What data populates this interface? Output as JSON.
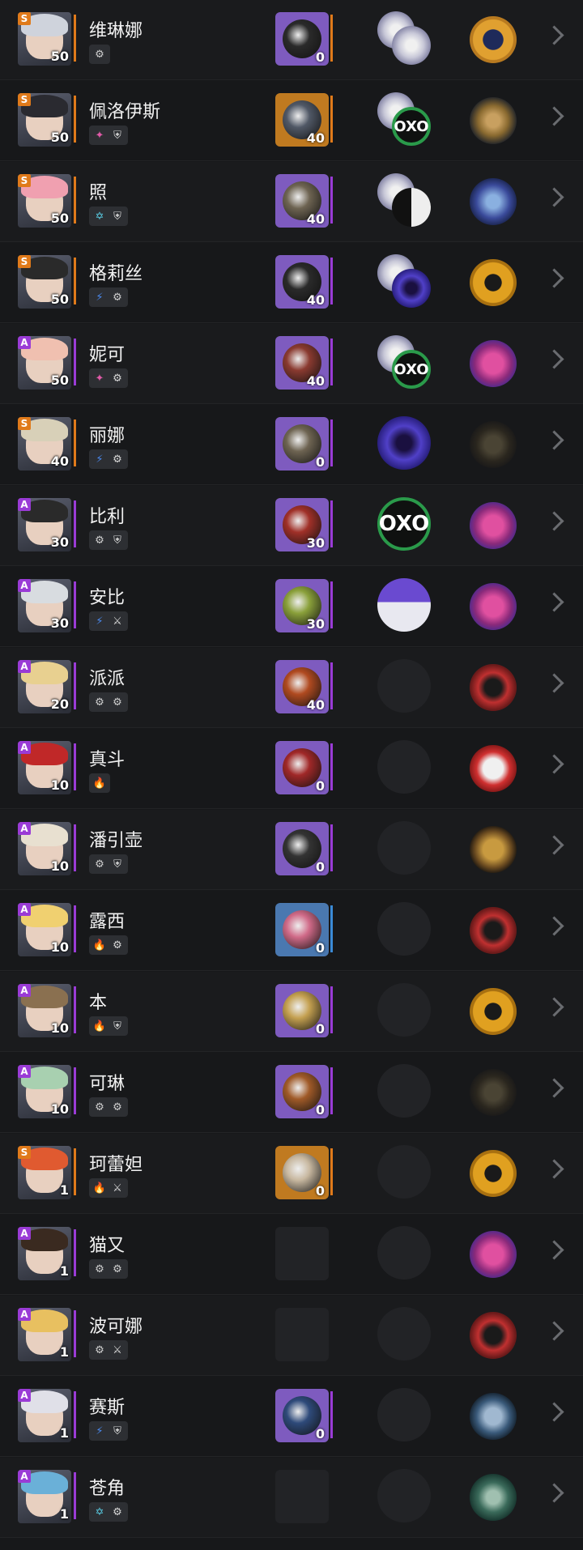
{
  "agents": [
    {
      "name": "维琳娜",
      "rank": "S",
      "level": "50",
      "tags": [
        "physical"
      ],
      "weapon": {
        "rank": "S",
        "level": "0",
        "color": "#7e5bbf",
        "core": "#2a2a2a"
      },
      "drive": [
        "disc-a",
        "disc-b"
      ],
      "faction": "orange"
    },
    {
      "name": "佩洛伊斯",
      "rank": "S",
      "level": "50",
      "tags": [
        "ether",
        "defense"
      ],
      "weapon": {
        "rank": "S",
        "level": "40",
        "color": "#c07a20",
        "core": "#505866"
      },
      "drive": [
        "disc-a",
        "oxo"
      ],
      "faction": "gold"
    },
    {
      "name": "照",
      "rank": "S",
      "level": "50",
      "tags": [
        "ice",
        "defense"
      ],
      "weapon": {
        "rank": "A",
        "level": "40",
        "color": "#7e5bbf",
        "core": "#6e6452"
      },
      "drive": [
        "disc-c",
        "yinyang"
      ],
      "faction": "blue"
    },
    {
      "name": "格莉丝",
      "rank": "S",
      "level": "50",
      "tags": [
        "electric",
        "physical"
      ],
      "weapon": {
        "rank": "A",
        "level": "40",
        "color": "#7e5bbf",
        "core": "#2a2a2a"
      },
      "drive": [
        "disc-d",
        "purple"
      ],
      "faction": "belobog"
    },
    {
      "name": "妮可",
      "rank": "A",
      "level": "50",
      "tags": [
        "ether",
        "support"
      ],
      "weapon": {
        "rank": "A",
        "level": "40",
        "color": "#7e5bbf",
        "core": "#8a3a30"
      },
      "drive": [
        "disc-a",
        "oxo"
      ],
      "faction": "bunny"
    },
    {
      "name": "丽娜",
      "rank": "S",
      "level": "40",
      "tags": [
        "electric",
        "support"
      ],
      "weapon": {
        "rank": "A",
        "level": "0",
        "color": "#7e5bbf",
        "core": "#6e6452"
      },
      "drive": [
        "purple"
      ],
      "faction": "dark"
    },
    {
      "name": "比利",
      "rank": "A",
      "level": "30",
      "tags": [
        "physical",
        "defense"
      ],
      "weapon": {
        "rank": "A",
        "level": "30",
        "color": "#7e5bbf",
        "core": "#a03028"
      },
      "drive": [
        "oxo"
      ],
      "faction": "bunny"
    },
    {
      "name": "安比",
      "rank": "A",
      "level": "30",
      "tags": [
        "electric",
        "attack"
      ],
      "weapon": {
        "rank": "A",
        "level": "30",
        "color": "#7e5bbf",
        "core": "#8aa03a"
      },
      "drive": [
        "stars"
      ],
      "faction": "bunny"
    },
    {
      "name": "派派",
      "rank": "A",
      "level": "20",
      "tags": [
        "physical",
        "physical"
      ],
      "weapon": {
        "rank": "A",
        "level": "40",
        "color": "#7e5bbf",
        "core": "#b04a20"
      },
      "drive": [
        "empty"
      ],
      "faction": "red"
    },
    {
      "name": "真斗",
      "rank": "A",
      "level": "10",
      "tags": [
        "fire"
      ],
      "weapon": {
        "rank": "A",
        "level": "0",
        "color": "#7e5bbf",
        "core": "#a02828"
      },
      "drive": [
        "empty"
      ],
      "faction": "redwhite"
    },
    {
      "name": "潘引壶",
      "rank": "A",
      "level": "10",
      "tags": [
        "physical",
        "defense"
      ],
      "weapon": {
        "rank": "A",
        "level": "0",
        "color": "#7e5bbf",
        "core": "#333333"
      },
      "drive": [
        "empty"
      ],
      "faction": "temple"
    },
    {
      "name": "露西",
      "rank": "A",
      "level": "10",
      "tags": [
        "fire",
        "support"
      ],
      "weapon": {
        "rank": "B",
        "level": "0",
        "color": "#4a78b0",
        "core": "#d06a88"
      },
      "drive": [
        "empty"
      ],
      "faction": "red"
    },
    {
      "name": "本",
      "rank": "A",
      "level": "10",
      "tags": [
        "fire",
        "defense"
      ],
      "weapon": {
        "rank": "A",
        "level": "0",
        "color": "#7e5bbf",
        "core": "#c4a050"
      },
      "drive": [
        "empty"
      ],
      "faction": "belobog"
    },
    {
      "name": "可琳",
      "rank": "A",
      "level": "10",
      "tags": [
        "physical",
        "physical"
      ],
      "weapon": {
        "rank": "A",
        "level": "0",
        "color": "#7e5bbf",
        "core": "#a05a28"
      },
      "drive": [
        "empty"
      ],
      "faction": "dark"
    },
    {
      "name": "珂蕾妲",
      "rank": "S",
      "level": "1",
      "tags": [
        "fire",
        "attack"
      ],
      "weapon": {
        "rank": "S",
        "level": "0",
        "color": "#c07a20",
        "core": "#c8b8a0"
      },
      "drive": [
        "empty"
      ],
      "faction": "belobog"
    },
    {
      "name": "猫又",
      "rank": "A",
      "level": "1",
      "tags": [
        "physical",
        "physical"
      ],
      "weapon": null,
      "drive": [
        "empty"
      ],
      "faction": "bunny"
    },
    {
      "name": "波可娜",
      "rank": "A",
      "level": "1",
      "tags": [
        "physical",
        "attack"
      ],
      "weapon": null,
      "drive": [
        "empty"
      ],
      "faction": "red"
    },
    {
      "name": "赛斯",
      "rank": "A",
      "level": "1",
      "tags": [
        "electric",
        "defense"
      ],
      "weapon": {
        "rank": "A",
        "level": "0",
        "color": "#7e5bbf",
        "core": "#2e4a7a"
      },
      "drive": [
        "empty"
      ],
      "faction": "police"
    },
    {
      "name": "苍角",
      "rank": "A",
      "level": "1",
      "tags": [
        "ice",
        "support"
      ],
      "weapon": null,
      "drive": [
        "empty"
      ],
      "faction": "green"
    }
  ],
  "colors": {
    "rank_S": "#e07a1a",
    "rank_A": "#9a3bd6",
    "rank_B": "#3a8ad6",
    "physical": "#cfcfcf",
    "ether": "#e05aa8",
    "ice": "#5ad0e8",
    "electric": "#4a8af0",
    "fire": "#f06a30",
    "support": "#d8d8d8",
    "defense": "#d8d8d8",
    "attack": "#d8d8d8"
  },
  "icons": {
    "physical": "⚙",
    "ether": "✦",
    "ice": "✡",
    "electric": "⚡",
    "fire": "🔥",
    "support": "⚙",
    "defense": "⛨",
    "attack": "⚔"
  },
  "drive_text": {
    "oxo": "OXO"
  }
}
